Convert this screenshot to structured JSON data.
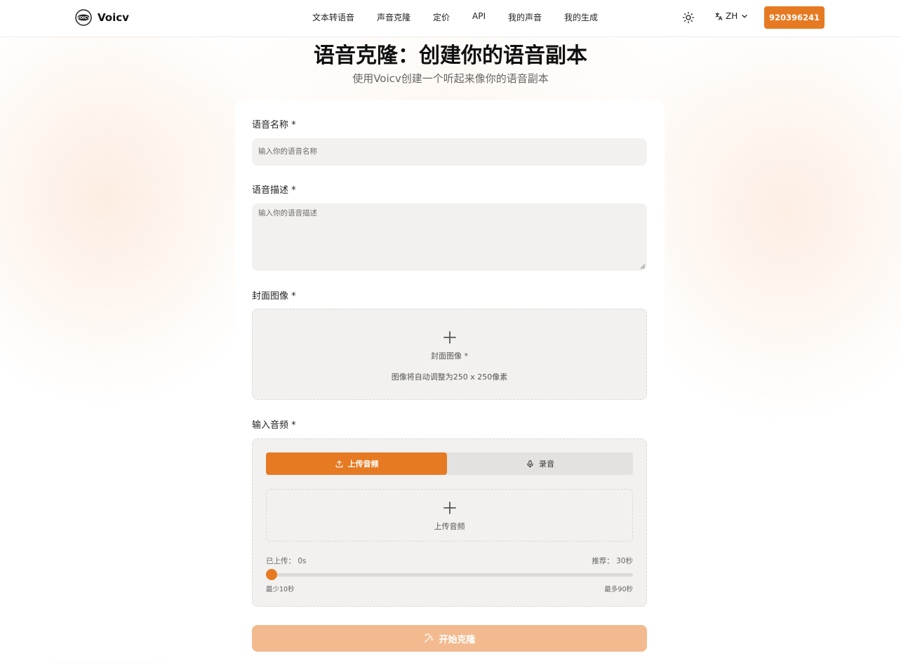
{
  "header": {
    "brand": "Voicv",
    "logo_text": "VOICV",
    "nav": [
      "文本转语音",
      "声音克隆",
      "定价",
      "API",
      "我的声音",
      "我的生成"
    ],
    "language": "ZH",
    "user_button": "920396241"
  },
  "page": {
    "title": "语音克隆：创建你的语音副本",
    "subtitle": "使用Voicv创建一个听起来像你的语音副本"
  },
  "form": {
    "name_label": "语音名称 *",
    "name_placeholder": "输入你的语音名称",
    "desc_label": "语音描述 *",
    "desc_placeholder": "输入你的语音描述",
    "cover_label": "封面图像 *",
    "cover_drop_title": "封面图像 *",
    "cover_drop_hint": "图像将自动调整为250 x 250像素",
    "audio_label": "输入音频 *",
    "tab_upload": "上传音频",
    "tab_record": "录音",
    "upload_drop_title": "上传音频",
    "uploaded_text": "已上传：  0s",
    "recommended_text": "推荐：  30秒",
    "min_text": "最少10秒",
    "max_text": "最多90秒",
    "uploaded_seconds": 0,
    "submit": "开始克隆"
  },
  "icons": {
    "theme": "sun-icon",
    "language": "translate-icon",
    "dropdown": "chevron-down-icon",
    "add": "plus-icon",
    "upload": "upload-icon",
    "record": "microphone-icon",
    "submit": "magic-wand-icon"
  },
  "colors": {
    "accent": "#e67a22",
    "accent_disabled": "#f2ba8e",
    "field_bg": "#f2f1ef"
  }
}
